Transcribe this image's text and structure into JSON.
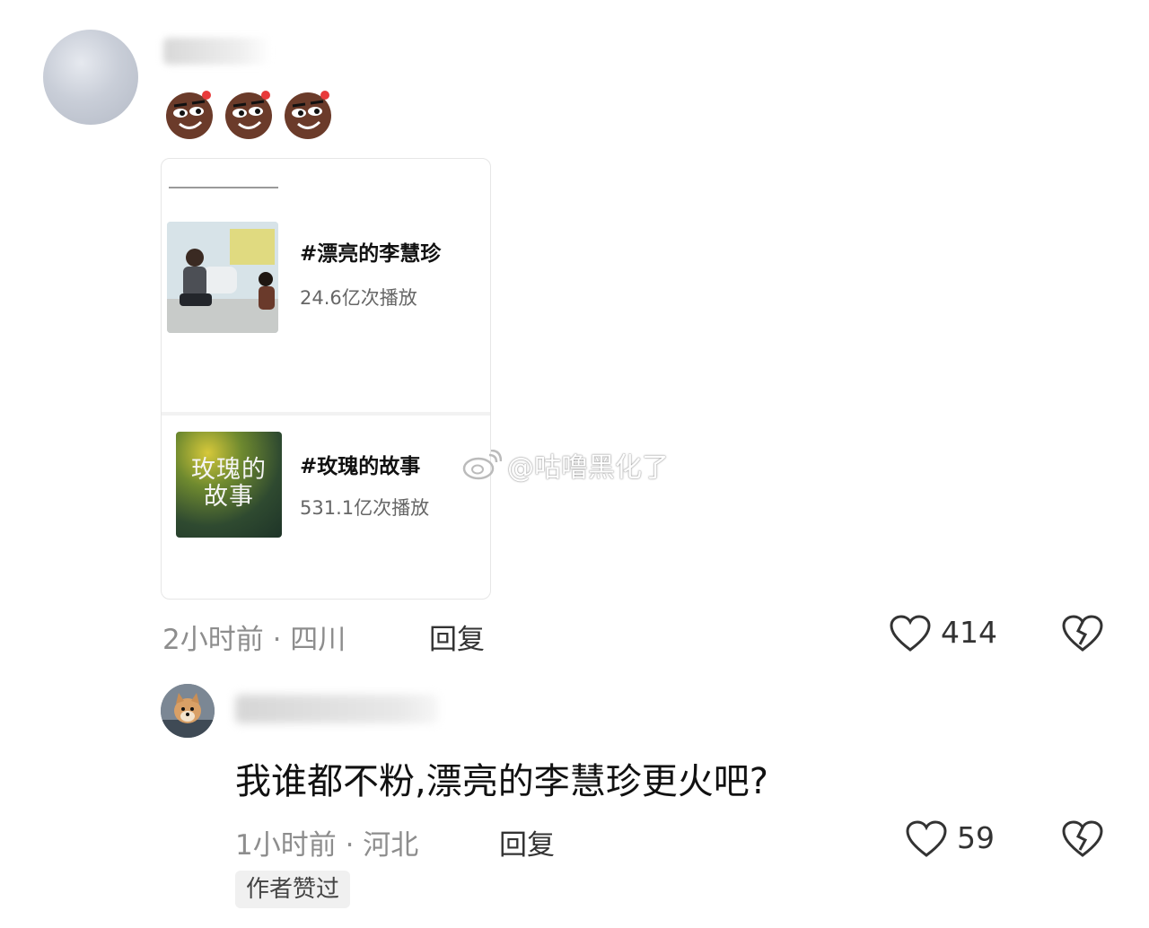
{
  "main_comment": {
    "emoji_icons": [
      "smirk-emoji-icon",
      "smirk-emoji-icon",
      "smirk-emoji-icon"
    ],
    "card": {
      "topics": [
        {
          "title": "#漂亮的李慧珍",
          "count": "24.6亿次播放"
        },
        {
          "title": "#玫瑰的故事",
          "count": "531.1亿次播放",
          "thumb_text": [
            "玫瑰的",
            "故事"
          ]
        }
      ]
    },
    "time_location": "2小时前 · 四川",
    "reply_label": "回复",
    "like_count": "414"
  },
  "reply_comment": {
    "text": "我谁都不粉,漂亮的李慧珍更火吧?",
    "time_location": "1小时前 · 河北",
    "reply_label": "回复",
    "like_count": "59",
    "badge": "作者赞过"
  },
  "watermark": {
    "text": "@咕噜黑化了"
  }
}
